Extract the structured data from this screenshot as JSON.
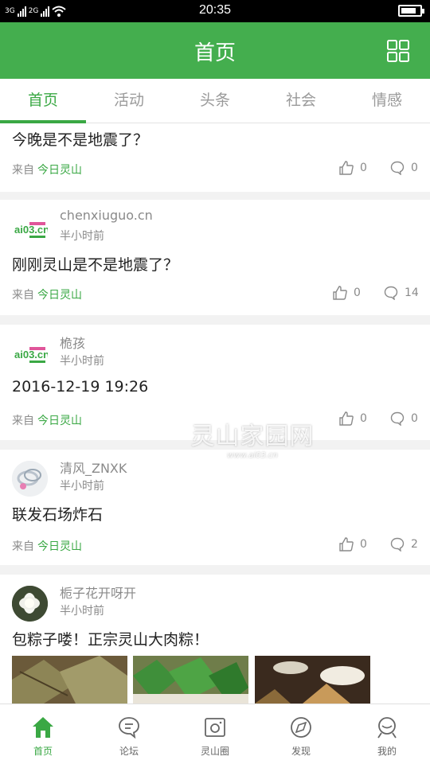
{
  "status_bar": {
    "left_indicators": [
      "3G",
      "2G"
    ],
    "time": "20:35",
    "battery_level": 0.8
  },
  "header": {
    "title": "首页",
    "grid_icon": "grid-icon"
  },
  "tabs": [
    {
      "label": "首页",
      "active": true
    },
    {
      "label": "活动",
      "active": false
    },
    {
      "label": "头条",
      "active": false
    },
    {
      "label": "社会",
      "active": false
    },
    {
      "label": "情感",
      "active": false
    }
  ],
  "feed": {
    "source_prefix": "来自",
    "posts": [
      {
        "text": "今晚是不是地震了？",
        "source": "今日灵山",
        "likes": "0",
        "comments": "0"
      },
      {
        "user": "chenxiuguo.cn",
        "time": "半小时前",
        "avatar_text": "ai03.cn",
        "text": "刚刚灵山是不是地震了？",
        "source": "今日灵山",
        "likes": "0",
        "comments": "14"
      },
      {
        "user": "桅孩",
        "time": "半小时前",
        "avatar_text": "ai03.cn",
        "text": "2016-12-19 19:26",
        "source": "今日灵山",
        "likes": "0",
        "comments": "0"
      },
      {
        "user": "清风_ZNXK",
        "time": "半小时前",
        "text": "联发石场炸石",
        "source": "今日灵山",
        "likes": "0",
        "comments": "2"
      },
      {
        "user": "栀子花开呀开",
        "time": "半小时前",
        "text": "包粽子喽！正宗灵山大肉粽！"
      }
    ]
  },
  "watermark": {
    "main": "灵山家园网",
    "sub": "www.ai03.cn"
  },
  "bottom_nav": [
    {
      "label": "首页",
      "icon": "home-icon",
      "active": true
    },
    {
      "label": "论坛",
      "icon": "chat-bubble-icon",
      "active": false
    },
    {
      "label": "灵山圈",
      "icon": "camera-circle-icon",
      "active": false
    },
    {
      "label": "发现",
      "icon": "compass-icon",
      "active": false
    },
    {
      "label": "我的",
      "icon": "user-icon",
      "active": false
    }
  ],
  "colors": {
    "brand_green": "#44ae4e",
    "accent_green": "#3aa844",
    "text_gray": "#8a8a8a"
  }
}
